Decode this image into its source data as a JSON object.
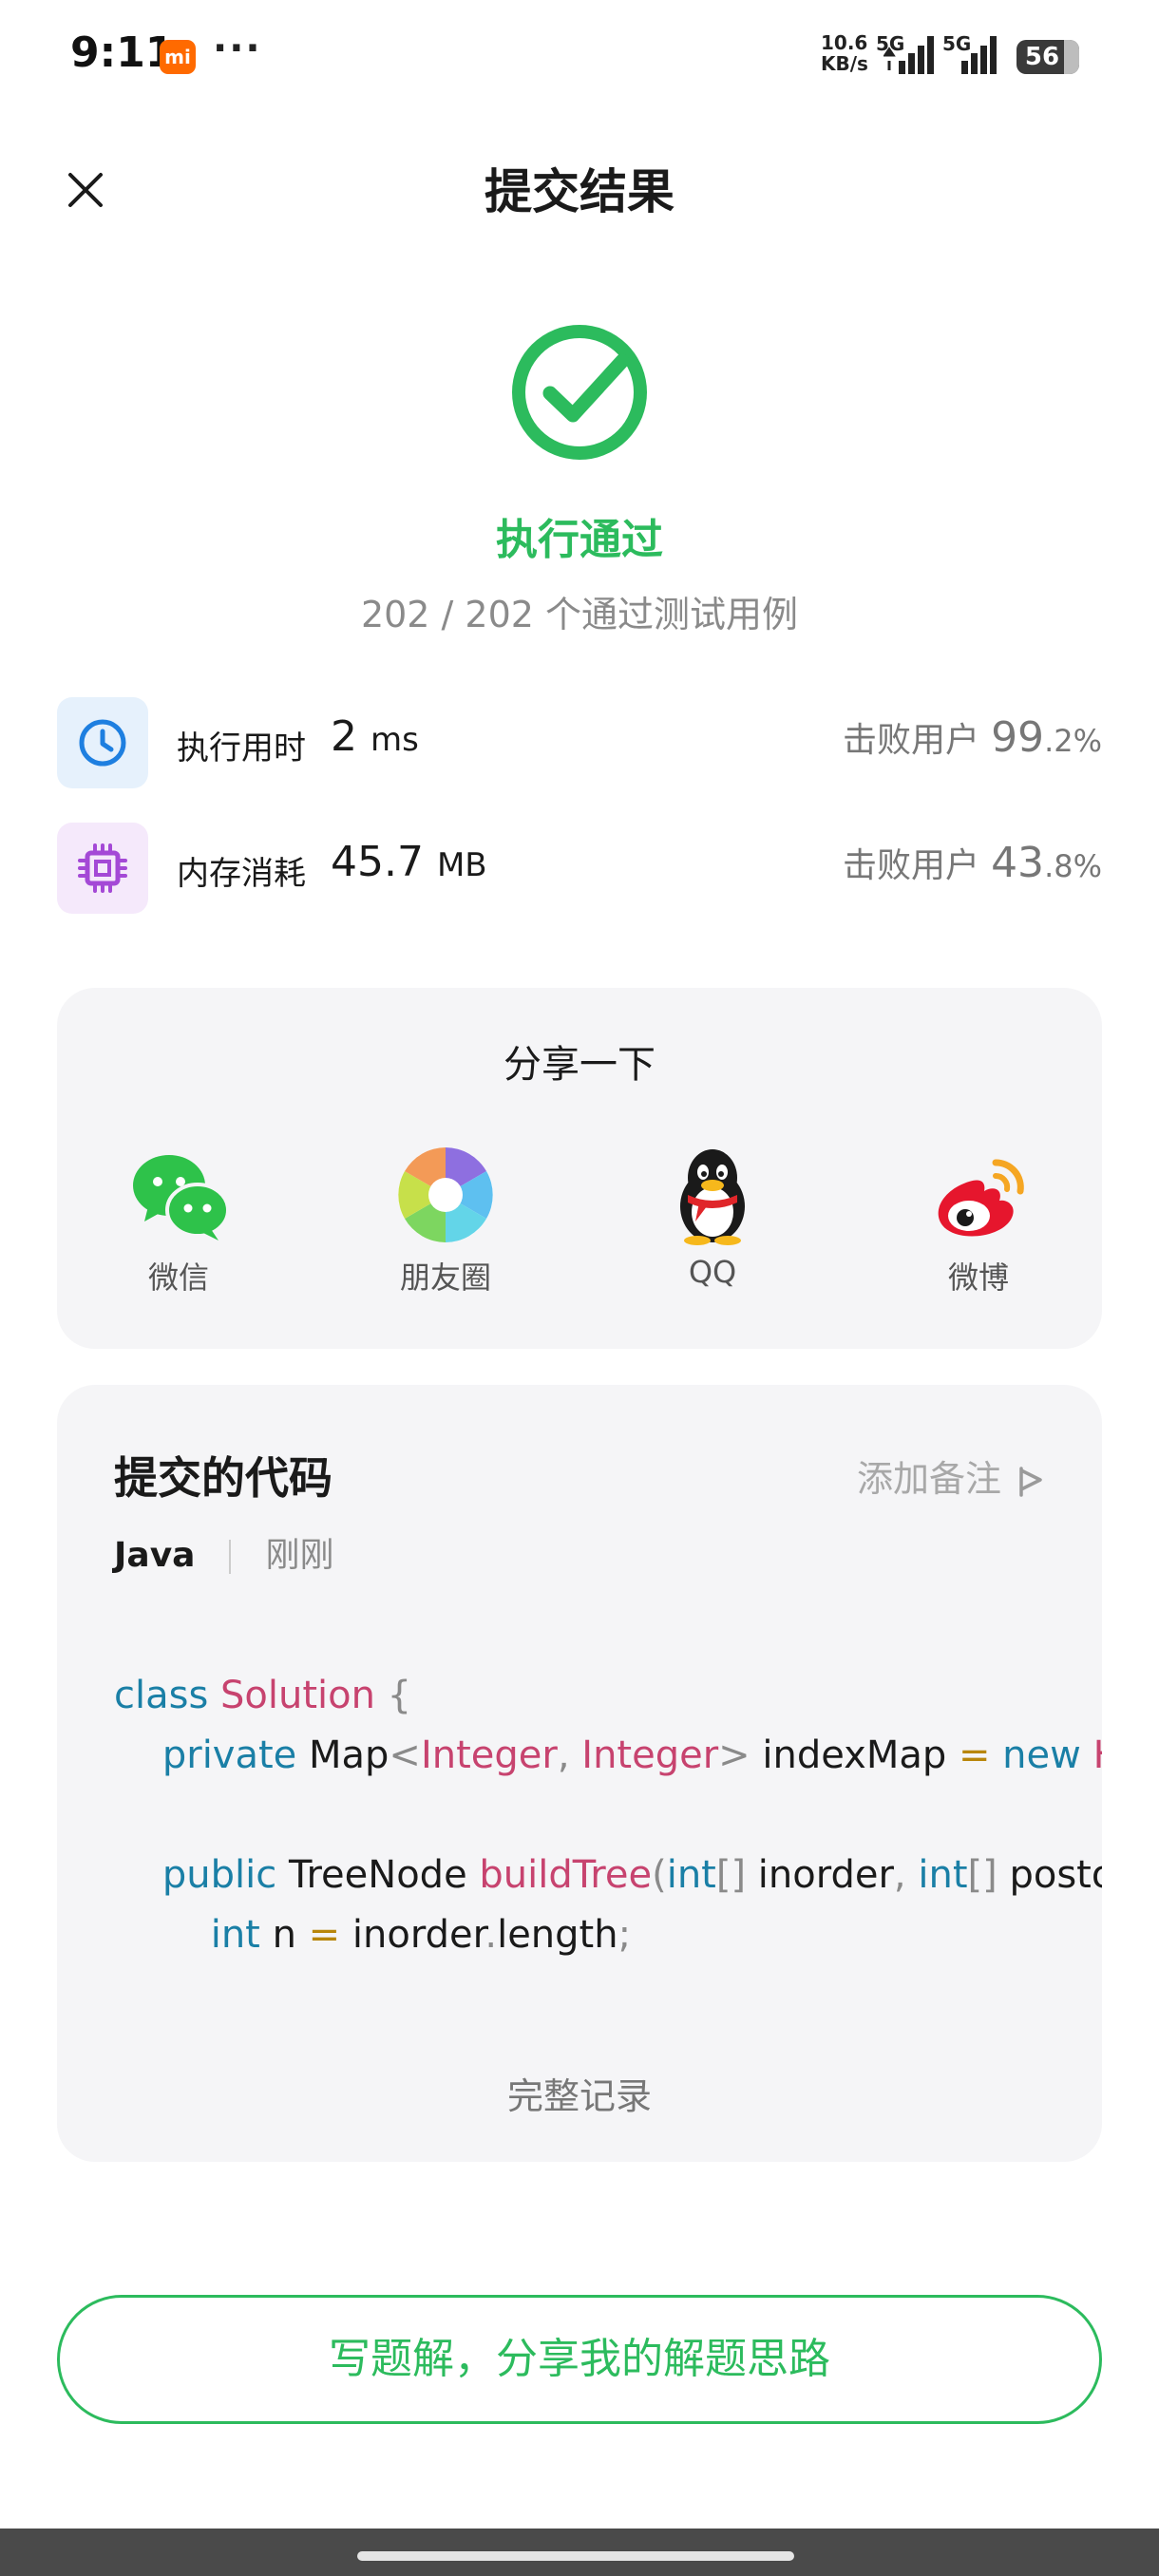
{
  "status_bar": {
    "time": "9:11",
    "mi_badge": "mi",
    "dots": "···",
    "net_speed_value": "10.6",
    "net_speed_unit": "KB/s",
    "sim1_label": "5G",
    "sim2_label": "5G",
    "battery": "56"
  },
  "header": {
    "title": "提交结果"
  },
  "result": {
    "status": "执行通过",
    "count_text": "202 / 202 个通过测试用例",
    "accent_color": "#2cbb5d"
  },
  "stats": [
    {
      "label": "执行用时",
      "value": "2",
      "unit": "ms",
      "beat_label": "击败用户",
      "beat_int": "99",
      "beat_dec": ".2%",
      "icon": "clock-icon"
    },
    {
      "label": "内存消耗",
      "value": "45.7",
      "unit": "MB",
      "beat_label": "击败用户",
      "beat_int": "43",
      "beat_dec": ".8%",
      "icon": "chip-icon"
    }
  ],
  "share": {
    "title": "分享一下",
    "items": [
      {
        "label": "微信",
        "icon": "wechat-icon"
      },
      {
        "label": "朋友圈",
        "icon": "moments-icon"
      },
      {
        "label": "QQ",
        "icon": "qq-icon"
      },
      {
        "label": "微博",
        "icon": "weibo-icon"
      }
    ]
  },
  "code": {
    "title": "提交的代码",
    "add_note": "添加备注",
    "language": "Java",
    "time": "刚刚",
    "lines": [
      [
        {
          "t": "class ",
          "c": "kw"
        },
        {
          "t": "Solution",
          "c": "type"
        },
        {
          "t": " {",
          "c": "punc"
        }
      ],
      [
        {
          "t": "    private ",
          "c": "kw"
        },
        {
          "t": "Map",
          "c": "plain"
        },
        {
          "t": "<",
          "c": "punc"
        },
        {
          "t": "Integer",
          "c": "type"
        },
        {
          "t": ", ",
          "c": "punc"
        },
        {
          "t": "Integer",
          "c": "type"
        },
        {
          "t": ">",
          "c": "punc"
        },
        {
          "t": " indexMap ",
          "c": "plain"
        },
        {
          "t": "=",
          "c": "op"
        },
        {
          "t": " new ",
          "c": "kw"
        },
        {
          "t": "Has",
          "c": "type"
        }
      ],
      [],
      [
        {
          "t": "    public ",
          "c": "kw"
        },
        {
          "t": "TreeNode ",
          "c": "plain"
        },
        {
          "t": "buildTree",
          "c": "type"
        },
        {
          "t": "(",
          "c": "punc"
        },
        {
          "t": "int",
          "c": "kw"
        },
        {
          "t": "[]",
          "c": "punc"
        },
        {
          "t": " inorder",
          "c": "plain"
        },
        {
          "t": ", ",
          "c": "punc"
        },
        {
          "t": "int",
          "c": "kw"
        },
        {
          "t": "[]",
          "c": "punc"
        },
        {
          "t": " posto",
          "c": "plain"
        }
      ],
      [
        {
          "t": "        int ",
          "c": "kw"
        },
        {
          "t": "n ",
          "c": "plain"
        },
        {
          "t": "=",
          "c": "op"
        },
        {
          "t": " inorder",
          "c": "plain"
        },
        {
          "t": ".",
          "c": "punc"
        },
        {
          "t": "length",
          "c": "plain"
        },
        {
          "t": ";",
          "c": "punc"
        }
      ]
    ],
    "full_record": "完整记录"
  },
  "write_button": "写题解，分享我的解题思路"
}
